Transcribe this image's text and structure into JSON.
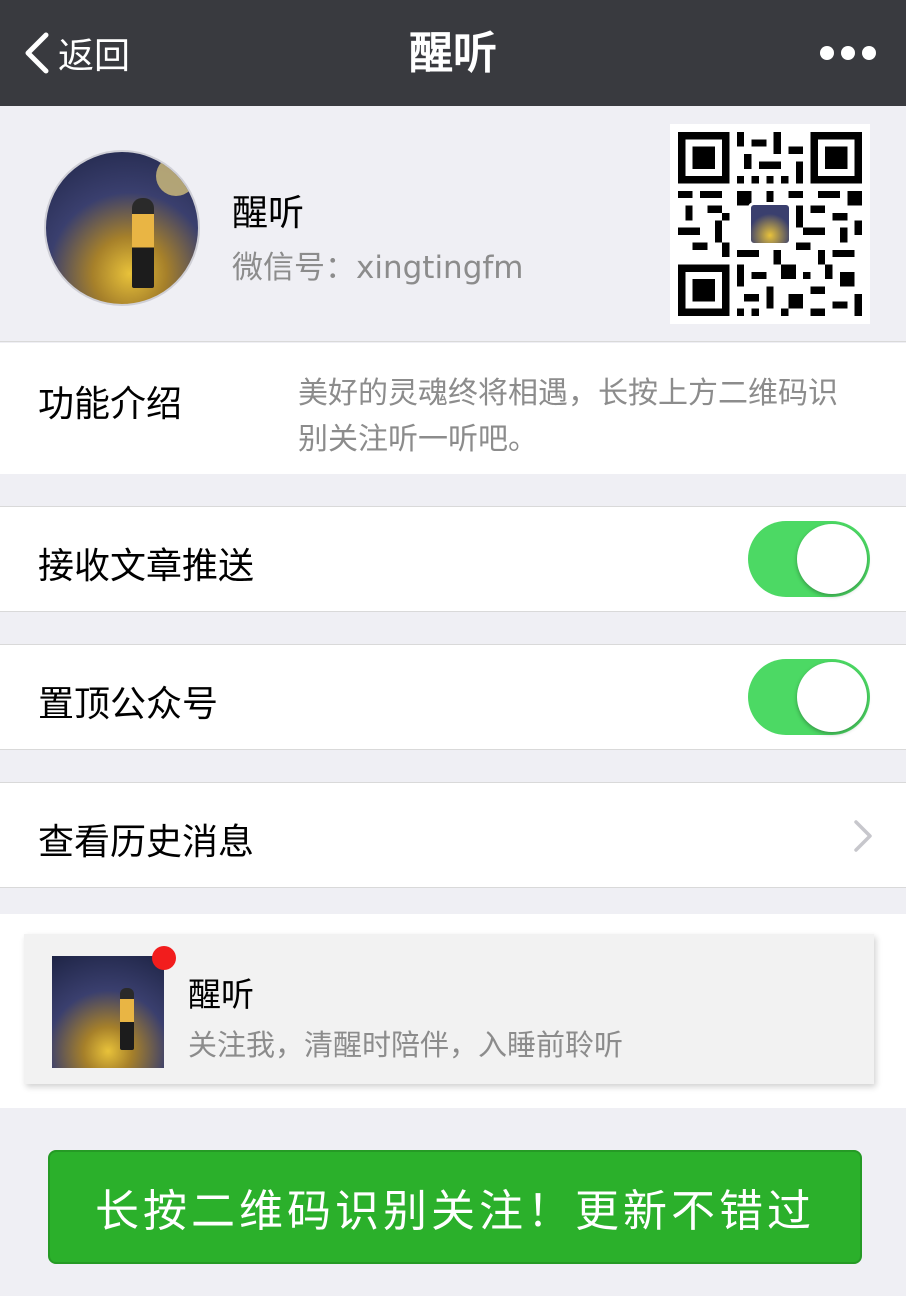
{
  "navbar": {
    "back_label": "返回",
    "title": "醒听",
    "more_icon": "more-dots-icon"
  },
  "profile": {
    "name": "醒听",
    "wechat_id": "微信号：xingtingfm"
  },
  "intro": {
    "label": "功能介绍",
    "text": "美好的灵魂终将相遇，长按上方二维码识别关注听一听吧。"
  },
  "settings": {
    "receive_push": {
      "label": "接收文章推送",
      "enabled": true
    },
    "pin_top": {
      "label": "置顶公众号",
      "enabled": true
    },
    "history": {
      "label": "查看历史消息"
    }
  },
  "card": {
    "title": "醒听",
    "desc": "关注我，清醒时陪伴，入睡前聆听",
    "has_badge": true
  },
  "follow_button": {
    "label": "长按二维码识别关注！更新不错过"
  },
  "colors": {
    "navbar": "#393a3f",
    "toggle_on": "#4cd964",
    "button_green": "#2bb02b",
    "badge_red": "#f21d1d"
  }
}
